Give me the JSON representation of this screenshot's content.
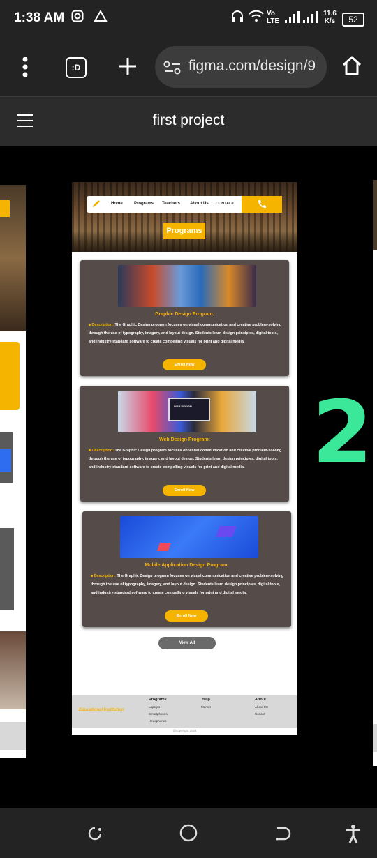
{
  "status_bar": {
    "time": "1:38 AM",
    "network": "Vo LTE",
    "speed": "11.6",
    "speed_unit": "K/s",
    "battery": "52"
  },
  "browser": {
    "url": "figma.com/design/9",
    "tab_label": ":D"
  },
  "figma": {
    "title": "first project"
  },
  "artboard": {
    "nav_links": [
      "Home",
      "Programs",
      "Teachers",
      "About Us",
      "CONTACT"
    ],
    "hero_badge": "Programs",
    "cards": [
      {
        "title": "Graphic Design Program:",
        "desc_label": "Description:",
        "desc": "The Graphic Design program focuses on visual communication and creative problem-solving through the use of typography, imagery, and layout design. Students learn design principles, digital tools, and industry-standard software to create compelling visuals for print and digital media.",
        "button": "Enroll Now"
      },
      {
        "title": "Web Design Program:",
        "desc_label": "Description:",
        "desc": "The Graphic Design program focuses on visual communication and creative problem-solving through the use of typography, imagery, and layout design. Students learn design principles, digital tools, and industry-standard software to create compelling visuals for print and digital media.",
        "button": "Enroll Now",
        "image_text": "WEB DESIGN"
      },
      {
        "title": "Mobile Application  Design Program:",
        "desc_label": "Description:",
        "desc": "The Graphic Design program focuses on visual communication and creative problem-solving through the use of typography, imagery, and layout design. Students learn design principles, digital tools, and industry-standard software to create compelling visuals for print and digital media.",
        "button": "Enroll Now"
      }
    ],
    "view_all": "View All",
    "footer": {
      "brand": "Educational Institution",
      "col1_title": "Programs",
      "col1_items": [
        "Laptops",
        "Smartphones",
        "Headphones"
      ],
      "col2_title": "Help",
      "col2_items": [
        "Market"
      ],
      "col3_title": "About",
      "col3_items": [
        "About Me",
        "Conact"
      ],
      "copyright": "@copyright 2024"
    }
  },
  "annotation": "2",
  "colors": {
    "accent": "#f4b400",
    "card_bg": "#554b48",
    "annotation": "#3be89a"
  }
}
